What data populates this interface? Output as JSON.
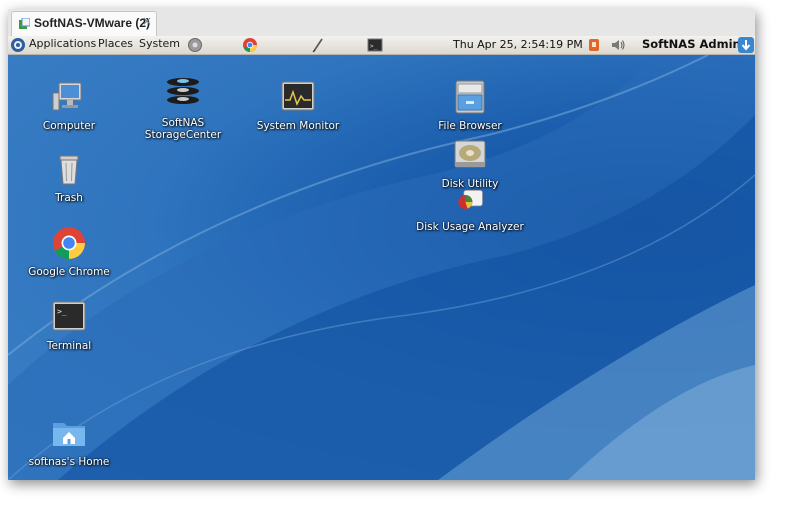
{
  "window": {
    "tab_title": "SoftNAS-VMware (2)",
    "tab_close": "×"
  },
  "panel": {
    "menus": [
      "Applications",
      "Places",
      "System"
    ],
    "clock": "Thu Apr 25,  2:54:19 PM",
    "user": "SoftNAS Admin"
  },
  "desktop": {
    "icons": [
      {
        "label": "Computer",
        "icon": "computer-icon"
      },
      {
        "label": "Trash",
        "icon": "trash-icon"
      },
      {
        "label": "Google Chrome",
        "icon": "chrome-icon"
      },
      {
        "label": "Terminal",
        "icon": "terminal-icon"
      },
      {
        "label": "softnas's Home",
        "icon": "home-folder-icon"
      },
      {
        "label_line1": "SoftNAS",
        "label_line2": "StorageCenter",
        "icon": "softnas-icon"
      },
      {
        "label": "System Monitor",
        "icon": "system-monitor-icon"
      },
      {
        "label": "File Browser",
        "icon": "file-browser-icon"
      },
      {
        "label": "Disk Utility",
        "icon": "disk-utility-icon"
      },
      {
        "label": "Disk Usage Analyzer",
        "icon": "disk-usage-analyzer-icon"
      }
    ]
  },
  "colors": {
    "desktop_blue": "#2f74be",
    "panel_bg": "#e8e5df"
  }
}
